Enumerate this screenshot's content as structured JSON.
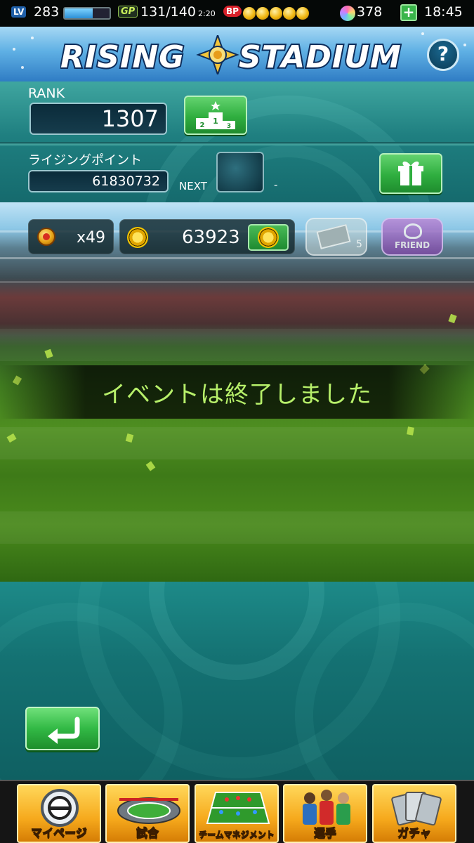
{
  "status_bar": {
    "level_badge": "LV",
    "level": "283",
    "level_progress": 0.62,
    "gp_badge": "GP",
    "gp_value": "131/140",
    "gp_recover_time": "2:20",
    "bp_badge": "BP",
    "bp_coins": 5,
    "gems": "378",
    "add_label": "+",
    "clock": "18:45"
  },
  "header": {
    "logo_left": "RISING",
    "logo_right": "STADIUM",
    "help_label": "?"
  },
  "rank_panel": {
    "rank_label": "RANK",
    "rank_value": "1307",
    "ranking_icon": "podium-icon",
    "points_label": "ライジングポイント",
    "points_value": "61830732",
    "next_label": "NEXT",
    "next_value": "-",
    "reward_icon": "gift-icon"
  },
  "items_bar": {
    "ball_count": "x49",
    "medal_count": "63923",
    "ticket_count": "5",
    "friend_label": "FRIEND"
  },
  "notice": {
    "message": "イベントは終了しました"
  },
  "back_button": {
    "icon": "return-arrow-icon"
  },
  "bottom_nav": [
    {
      "label": "マイページ",
      "icon": "efootball-logo-icon"
    },
    {
      "label": "試合",
      "icon": "stadium-icon"
    },
    {
      "label": "チームマネジメント",
      "icon": "formation-icon"
    },
    {
      "label": "選手",
      "icon": "players-icon"
    },
    {
      "label": "ガチャ",
      "icon": "cards-icon"
    }
  ],
  "colors": {
    "panel_teal": "#1f7f80",
    "accent_green": "#32b945",
    "notice_text": "#b7f06a",
    "nav_gold": "#f6a91c"
  }
}
